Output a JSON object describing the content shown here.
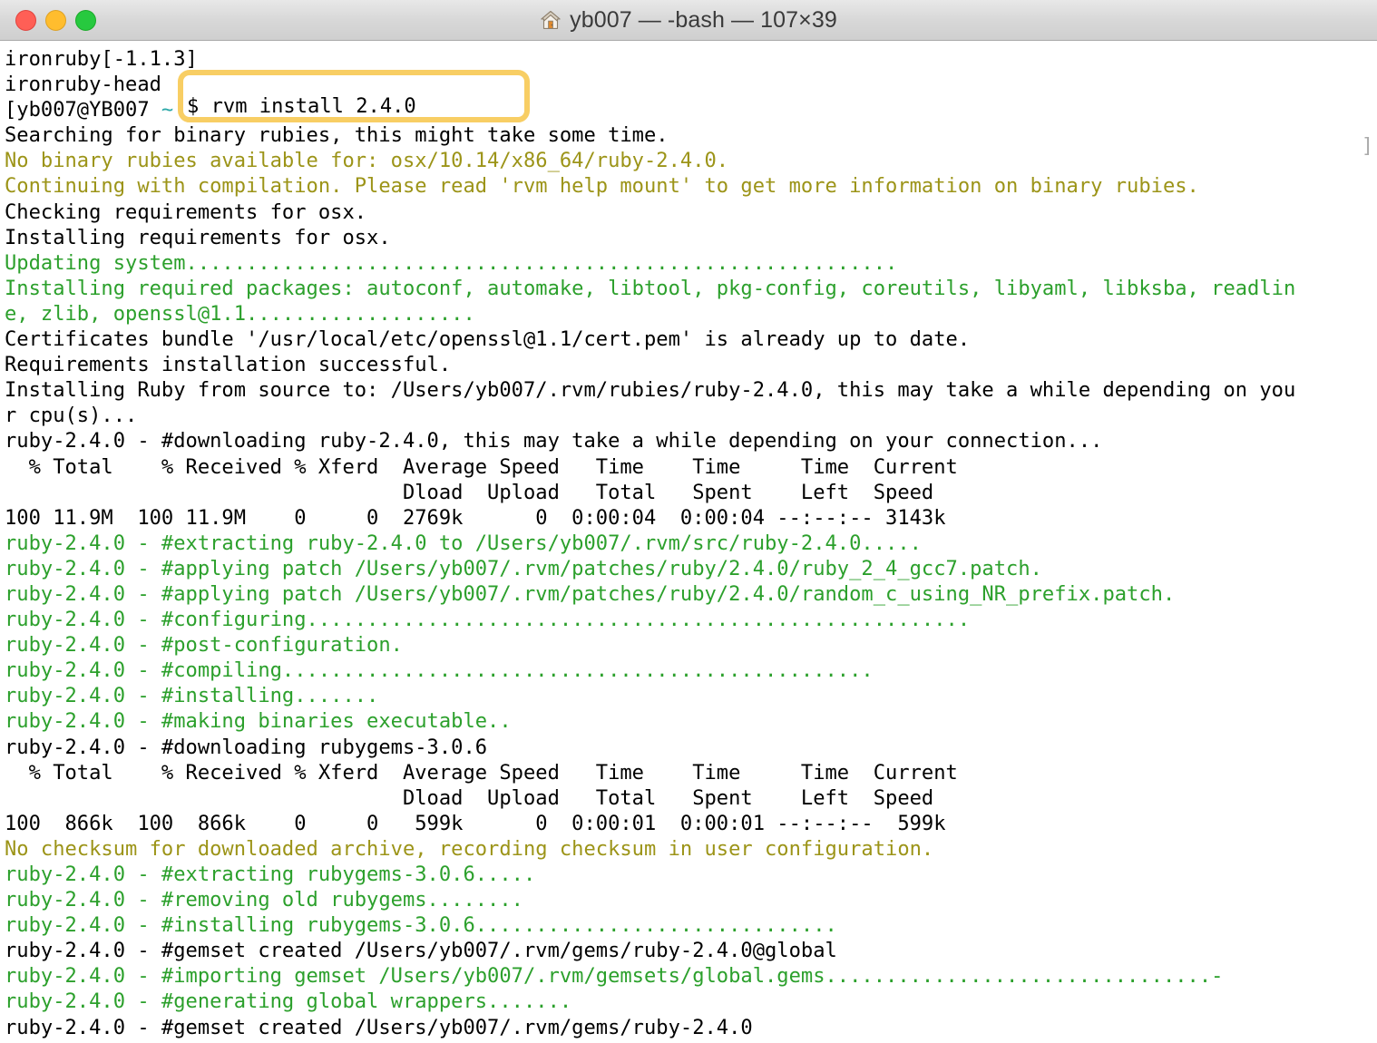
{
  "window": {
    "title": "yb007 — -bash — 107×39",
    "home_icon": "home-icon",
    "traffic_lights": {
      "close_label": "close",
      "minimize_label": "minimize",
      "maximize_label": "maximize",
      "close_color": "#ff5f56",
      "minimize_color": "#ffbd2e",
      "maximize_color": "#27c93f"
    }
  },
  "colors": {
    "background": "#ffffff",
    "text": "#000000",
    "green": "#2ca02c",
    "yellow": "#9c9418",
    "cyan": "#2aa8a8",
    "gray": "#aaaaaa",
    "highlight_border": "#f8ce64",
    "titlebar": "#d8d8d8"
  },
  "annotation": {
    "type": "rounded-rectangle-highlight",
    "target_text": "$ rvm install 2.4.0",
    "border_color": "#f8ce64"
  },
  "prompt": {
    "prefix": "[yb007@YB007 ",
    "tilde": "~",
    "command": "$ rvm install 2.4.0",
    "right_bracket": "]"
  },
  "terminal": {
    "cols": 107,
    "rows": 39,
    "lines": [
      {
        "color": "black",
        "text": "ironruby[-1.1.3]"
      },
      {
        "color": "black",
        "text": "ironruby-head"
      },
      {
        "color": "prompt",
        "text": "[yb007@YB007 ~ $ rvm install 2.4.0"
      },
      {
        "color": "black",
        "text": "Searching for binary rubies, this might take some time."
      },
      {
        "color": "yellow",
        "text": "No binary rubies available for: osx/10.14/x86_64/ruby-2.4.0."
      },
      {
        "color": "yellow",
        "text": "Continuing with compilation. Please read 'rvm help mount' to get more information on binary rubies."
      },
      {
        "color": "black",
        "text": "Checking requirements for osx."
      },
      {
        "color": "black",
        "text": "Installing requirements for osx."
      },
      {
        "color": "green",
        "text": "Updating system..........................................................."
      },
      {
        "color": "green",
        "text": "Installing required packages: autoconf, automake, libtool, pkg-config, coreutils, libyaml, libksba, readlin"
      },
      {
        "color": "green",
        "text": "e, zlib, openssl@1.1..................."
      },
      {
        "color": "black",
        "text": "Certificates bundle '/usr/local/etc/openssl@1.1/cert.pem' is already up to date."
      },
      {
        "color": "black",
        "text": "Requirements installation successful."
      },
      {
        "color": "black",
        "text": "Installing Ruby from source to: /Users/yb007/.rvm/rubies/ruby-2.4.0, this may take a while depending on you"
      },
      {
        "color": "black",
        "text": "r cpu(s)..."
      },
      {
        "color": "black",
        "text": "ruby-2.4.0 - #downloading ruby-2.4.0, this may take a while depending on your connection..."
      },
      {
        "color": "black",
        "text": "  % Total    % Received % Xferd  Average Speed   Time    Time     Time  Current"
      },
      {
        "color": "black",
        "text": "                                 Dload  Upload   Total   Spent    Left  Speed"
      },
      {
        "color": "black",
        "text": "100 11.9M  100 11.9M    0     0  2769k      0  0:00:04  0:00:04 --:--:-- 3143k"
      },
      {
        "color": "green",
        "text": "ruby-2.4.0 - #extracting ruby-2.4.0 to /Users/yb007/.rvm/src/ruby-2.4.0....."
      },
      {
        "color": "green",
        "text": "ruby-2.4.0 - #applying patch /Users/yb007/.rvm/patches/ruby/2.4.0/ruby_2_4_gcc7.patch."
      },
      {
        "color": "green",
        "text": "ruby-2.4.0 - #applying patch /Users/yb007/.rvm/patches/ruby/2.4.0/random_c_using_NR_prefix.patch."
      },
      {
        "color": "green",
        "text": "ruby-2.4.0 - #configuring......................................................."
      },
      {
        "color": "green",
        "text": "ruby-2.4.0 - #post-configuration."
      },
      {
        "color": "green",
        "text": "ruby-2.4.0 - #compiling................................................."
      },
      {
        "color": "green",
        "text": "ruby-2.4.0 - #installing......."
      },
      {
        "color": "green",
        "text": "ruby-2.4.0 - #making binaries executable.."
      },
      {
        "color": "black",
        "text": "ruby-2.4.0 - #downloading rubygems-3.0.6"
      },
      {
        "color": "black",
        "text": "  % Total    % Received % Xferd  Average Speed   Time    Time     Time  Current"
      },
      {
        "color": "black",
        "text": "                                 Dload  Upload   Total   Spent    Left  Speed"
      },
      {
        "color": "black",
        "text": "100  866k  100  866k    0     0   599k      0  0:00:01  0:00:01 --:--:--  599k"
      },
      {
        "color": "yellow",
        "text": "No checksum for downloaded archive, recording checksum in user configuration."
      },
      {
        "color": "green",
        "text": "ruby-2.4.0 - #extracting rubygems-3.0.6....."
      },
      {
        "color": "green",
        "text": "ruby-2.4.0 - #removing old rubygems........"
      },
      {
        "color": "green",
        "text": "ruby-2.4.0 - #installing rubygems-3.0.6.............................."
      },
      {
        "color": "black",
        "text": "ruby-2.4.0 - #gemset created /Users/yb007/.rvm/gems/ruby-2.4.0@global"
      },
      {
        "color": "green",
        "text": "ruby-2.4.0 - #importing gemset /Users/yb007/.rvm/gemsets/global.gems................................-"
      },
      {
        "color": "green",
        "text": "ruby-2.4.0 - #generating global wrappers......."
      },
      {
        "color": "black",
        "text": "ruby-2.4.0 - #gemset created /Users/yb007/.rvm/gems/ruby-2.4.0"
      }
    ]
  }
}
